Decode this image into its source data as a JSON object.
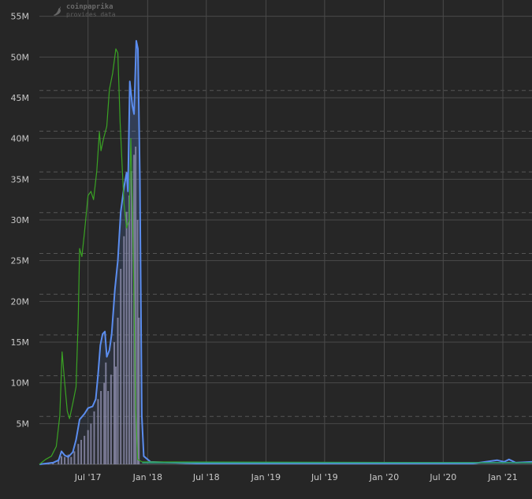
{
  "watermark": {
    "name": "coinpaprika",
    "sub": "provides data",
    "icon": "chili-pepper-icon"
  },
  "chart_data": {
    "type": "line",
    "title": "",
    "xlabel": "",
    "ylabel": "",
    "ylim": [
      0,
      57000000
    ],
    "grid": true,
    "y_ticks": [
      {
        "value": 5000000,
        "label": "5M"
      },
      {
        "value": 10000000,
        "label": "10M"
      },
      {
        "value": 15000000,
        "label": "15M"
      },
      {
        "value": 20000000,
        "label": "20M"
      },
      {
        "value": 25000000,
        "label": "25M"
      },
      {
        "value": 30000000,
        "label": "30M"
      },
      {
        "value": 35000000,
        "label": "35M"
      },
      {
        "value": 40000000,
        "label": "40M"
      },
      {
        "value": 45000000,
        "label": "45M"
      },
      {
        "value": 50000000,
        "label": "50M"
      },
      {
        "value": 55000000,
        "label": "55M"
      }
    ],
    "x_range": [
      "2017-02-01",
      "2021-04-01"
    ],
    "x_ticks": [
      {
        "date": "2017-07-01",
        "label": "Jul '17"
      },
      {
        "date": "2018-01-01",
        "label": "Jan '18"
      },
      {
        "date": "2018-07-01",
        "label": "Jul '18"
      },
      {
        "date": "2019-01-01",
        "label": "Jan '19"
      },
      {
        "date": "2019-07-01",
        "label": "Jul '19"
      },
      {
        "date": "2020-01-01",
        "label": "Jan '20"
      },
      {
        "date": "2020-07-01",
        "label": "Jul '20"
      },
      {
        "date": "2021-01-01",
        "label": "Jan '21"
      }
    ],
    "colors": {
      "background": "#262626",
      "grid": "#4a4a4a",
      "price": "#5b8def",
      "secondary": "#3aa324",
      "secondary_end": "#2e9c7a",
      "volume": "#8a8aa8"
    },
    "series": [
      {
        "key": "price_line",
        "color": "#5b8def",
        "points": [
          [
            "2017-02-01",
            0
          ],
          [
            "2017-03-15",
            200000
          ],
          [
            "2017-04-01",
            500000
          ],
          [
            "2017-04-10",
            1600000
          ],
          [
            "2017-04-20",
            1100000
          ],
          [
            "2017-05-01",
            900000
          ],
          [
            "2017-05-15",
            1500000
          ],
          [
            "2017-05-25",
            3000000
          ],
          [
            "2017-06-05",
            5500000
          ],
          [
            "2017-06-20",
            6200000
          ],
          [
            "2017-07-01",
            6900000
          ],
          [
            "2017-07-15",
            7100000
          ],
          [
            "2017-07-25",
            8000000
          ],
          [
            "2017-08-01",
            11000000
          ],
          [
            "2017-08-08",
            14600000
          ],
          [
            "2017-08-15",
            16000000
          ],
          [
            "2017-08-22",
            16300000
          ],
          [
            "2017-08-28",
            13200000
          ],
          [
            "2017-09-05",
            14000000
          ],
          [
            "2017-09-12",
            16000000
          ],
          [
            "2017-09-22",
            21500000
          ],
          [
            "2017-10-01",
            25000000
          ],
          [
            "2017-10-10",
            31000000
          ],
          [
            "2017-10-20",
            34000000
          ],
          [
            "2017-10-28",
            35800000
          ],
          [
            "2017-11-01",
            33500000
          ],
          [
            "2017-11-07",
            47000000
          ],
          [
            "2017-11-15",
            44000000
          ],
          [
            "2017-11-20",
            43000000
          ],
          [
            "2017-11-27",
            52000000
          ],
          [
            "2017-12-02",
            51000000
          ],
          [
            "2017-12-08",
            35000000
          ],
          [
            "2017-12-14",
            6000000
          ],
          [
            "2017-12-20",
            1000000
          ],
          [
            "2018-01-10",
            300000
          ],
          [
            "2018-06-01",
            100000
          ],
          [
            "2020-10-01",
            100000
          ],
          [
            "2020-12-15",
            500000
          ],
          [
            "2021-01-05",
            300000
          ],
          [
            "2021-01-20",
            600000
          ],
          [
            "2021-02-10",
            200000
          ],
          [
            "2021-04-01",
            300000
          ]
        ]
      },
      {
        "key": "secondary_line",
        "color": "#3aa324",
        "points": [
          [
            "2017-02-01",
            0
          ],
          [
            "2017-02-20",
            600000
          ],
          [
            "2017-03-10",
            1000000
          ],
          [
            "2017-03-25",
            2200000
          ],
          [
            "2017-04-05",
            6000000
          ],
          [
            "2017-04-12",
            13800000
          ],
          [
            "2017-04-20",
            10000000
          ],
          [
            "2017-04-28",
            6500000
          ],
          [
            "2017-05-05",
            5600000
          ],
          [
            "2017-05-15",
            7500000
          ],
          [
            "2017-05-25",
            9500000
          ],
          [
            "2017-06-01",
            18000000
          ],
          [
            "2017-06-05",
            26500000
          ],
          [
            "2017-06-12",
            25500000
          ],
          [
            "2017-06-20",
            28500000
          ],
          [
            "2017-07-01",
            33000000
          ],
          [
            "2017-07-10",
            33500000
          ],
          [
            "2017-07-18",
            32500000
          ],
          [
            "2017-07-28",
            36000000
          ],
          [
            "2017-08-05",
            40800000
          ],
          [
            "2017-08-10",
            38500000
          ],
          [
            "2017-08-18",
            40000000
          ],
          [
            "2017-08-28",
            41500000
          ],
          [
            "2017-09-05",
            46000000
          ],
          [
            "2017-09-15",
            48000000
          ],
          [
            "2017-09-25",
            51000000
          ],
          [
            "2017-10-01",
            50500000
          ],
          [
            "2017-10-08",
            42000000
          ],
          [
            "2017-10-15",
            36000000
          ],
          [
            "2017-10-20",
            32000000
          ],
          [
            "2017-10-28",
            29000000
          ],
          [
            "2017-11-05",
            30000000
          ],
          [
            "2017-11-10",
            40000000
          ],
          [
            "2017-11-15",
            32000000
          ],
          [
            "2017-11-25",
            7000000
          ],
          [
            "2017-12-01",
            600000
          ],
          [
            "2017-12-15",
            300000
          ],
          [
            "2021-04-01",
            200000
          ]
        ]
      }
    ],
    "volume_bars": [
      [
        "2017-03-01",
        100000
      ],
      [
        "2017-03-15",
        200000
      ],
      [
        "2017-04-01",
        600000
      ],
      [
        "2017-04-10",
        1000000
      ],
      [
        "2017-04-20",
        900000
      ],
      [
        "2017-05-01",
        1200000
      ],
      [
        "2017-05-10",
        900000
      ],
      [
        "2017-05-20",
        1600000
      ],
      [
        "2017-06-01",
        2500000
      ],
      [
        "2017-06-10",
        3000000
      ],
      [
        "2017-06-20",
        3500000
      ],
      [
        "2017-07-01",
        4200000
      ],
      [
        "2017-07-10",
        5000000
      ],
      [
        "2017-07-20",
        6500000
      ],
      [
        "2017-08-01",
        8000000
      ],
      [
        "2017-08-10",
        9000000
      ],
      [
        "2017-08-20",
        10000000
      ],
      [
        "2017-08-25",
        12500000
      ],
      [
        "2017-09-01",
        9000000
      ],
      [
        "2017-09-10",
        11000000
      ],
      [
        "2017-09-20",
        15000000
      ],
      [
        "2017-09-25",
        12000000
      ],
      [
        "2017-10-01",
        18000000
      ],
      [
        "2017-10-10",
        24000000
      ],
      [
        "2017-10-20",
        28000000
      ],
      [
        "2017-10-28",
        31000000
      ],
      [
        "2017-11-05",
        33000000
      ],
      [
        "2017-11-12",
        36000000
      ],
      [
        "2017-11-20",
        38000000
      ],
      [
        "2017-11-25",
        39000000
      ],
      [
        "2017-12-01",
        30000000
      ],
      [
        "2017-12-05",
        18000000
      ]
    ]
  }
}
